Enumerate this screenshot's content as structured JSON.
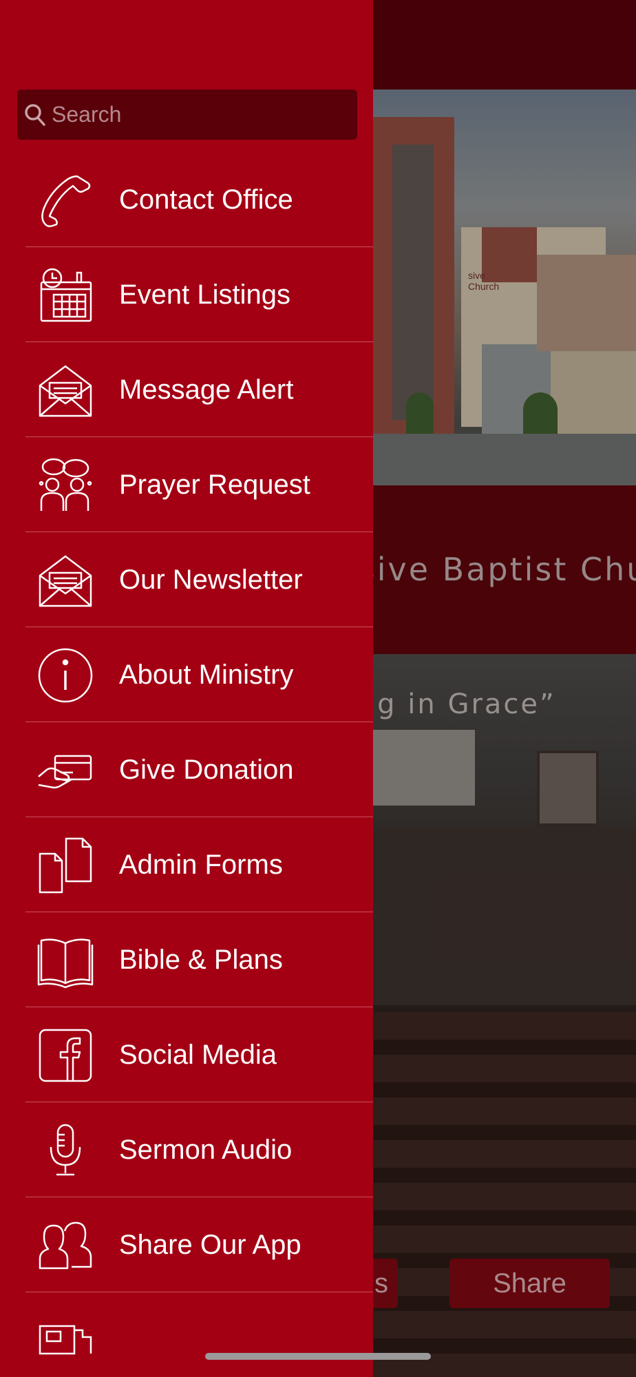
{
  "background": {
    "header_icons": [
      "inbox-icon",
      "gear-icon"
    ],
    "title_text": "gressive Baptist Church”",
    "tagline": "wing in Grace”",
    "buttons": {
      "partial_label": "s",
      "share_label": "Share"
    },
    "sign_text": "sive Church"
  },
  "drawer": {
    "search": {
      "placeholder": "Search",
      "value": ""
    },
    "items": [
      {
        "label": "Contact Office",
        "icon": "phone-icon"
      },
      {
        "label": "Event Listings",
        "icon": "calendar-clock-icon"
      },
      {
        "label": "Message Alert",
        "icon": "envelope-icon"
      },
      {
        "label": "Prayer Request",
        "icon": "people-chat-icon"
      },
      {
        "label": "Our Newsletter",
        "icon": "envelope-open-icon"
      },
      {
        "label": "About Ministry",
        "icon": "info-icon"
      },
      {
        "label": "Give Donation",
        "icon": "hand-card-icon"
      },
      {
        "label": "Admin Forms",
        "icon": "documents-icon"
      },
      {
        "label": "Bible & Plans",
        "icon": "open-book-icon"
      },
      {
        "label": "Social Media",
        "icon": "facebook-icon"
      },
      {
        "label": "Sermon Audio",
        "icon": "microphone-icon"
      },
      {
        "label": "Share Our App",
        "icon": "people-icon"
      },
      {
        "label": "",
        "icon": "photo-icon"
      }
    ]
  },
  "colors": {
    "drawer_bg": "#a30014",
    "search_bg": "#5a0009",
    "divider": "#c9505e",
    "text": "#ffffff"
  }
}
